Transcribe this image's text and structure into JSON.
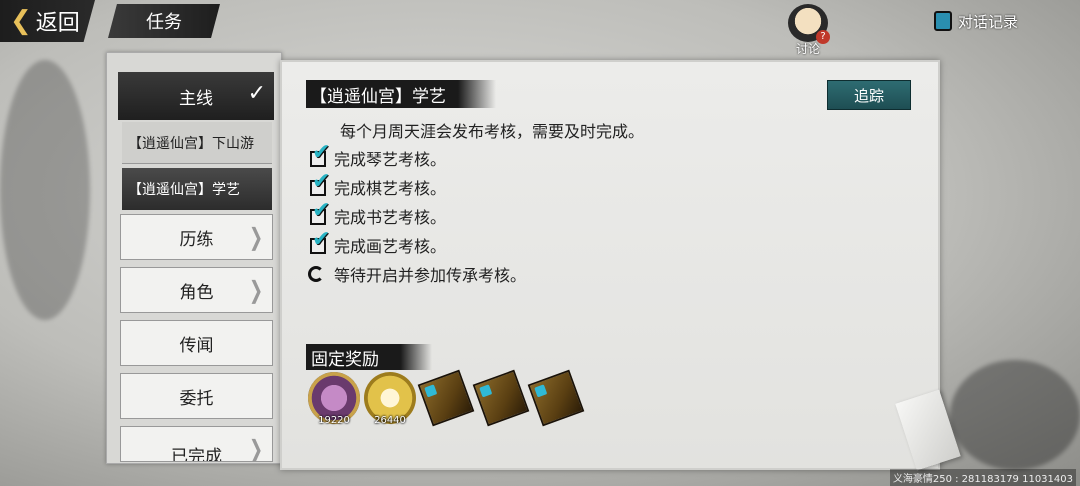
{
  "header": {
    "back_label": "返回",
    "page_title": "任务",
    "discuss_label": "讨论",
    "history_label": "对话记录"
  },
  "sidebar": {
    "main": {
      "label": "主线",
      "expanded": true
    },
    "sub_items": [
      {
        "label": "【逍遥仙宫】下山游"
      },
      {
        "label": "【逍遥仙宫】学艺",
        "selected": true
      }
    ],
    "items": [
      {
        "label": "历练",
        "has_arrow": true
      },
      {
        "label": "角色",
        "has_arrow": true
      },
      {
        "label": "传闻",
        "has_arrow": false
      },
      {
        "label": "委托",
        "has_arrow": false
      },
      {
        "label": "已完成",
        "has_arrow": true
      }
    ]
  },
  "quest": {
    "title": "【逍遥仙宫】学艺",
    "track_label": "追踪",
    "description": "每个月周天涯会发布考核，需要及时完成。",
    "objectives": [
      {
        "text": "完成琴艺考核。",
        "done": true
      },
      {
        "text": "完成棋艺考核。",
        "done": true
      },
      {
        "text": "完成书艺考核。",
        "done": true
      },
      {
        "text": "完成画艺考核。",
        "done": true
      },
      {
        "text": "等待开启并参加传承考核。",
        "done": false
      }
    ],
    "reward_title": "固定奖励",
    "rewards": [
      {
        "icon": "purple-coin-icon",
        "count": "19220"
      },
      {
        "icon": "gold-coin-icon",
        "count": "26440"
      },
      {
        "icon": "book-icon",
        "count": ""
      },
      {
        "icon": "book-icon",
        "count": ""
      },
      {
        "icon": "book-icon",
        "count": ""
      }
    ]
  },
  "footer": {
    "text": "义海豪情250 : 281183179  11031403"
  }
}
